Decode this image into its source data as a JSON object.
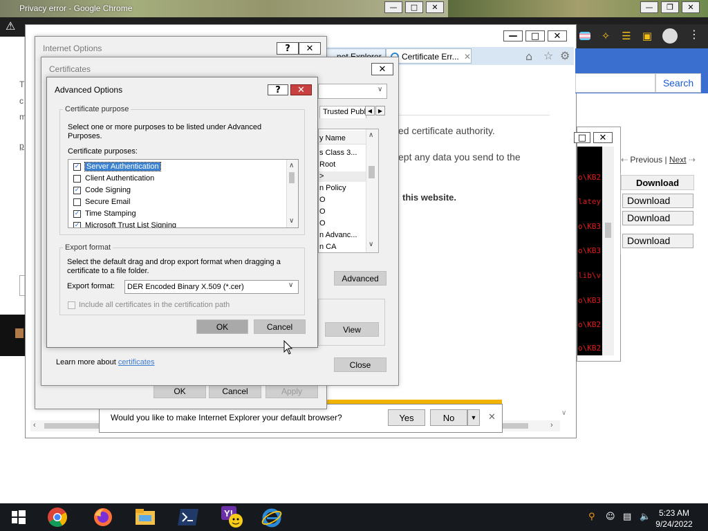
{
  "chrome": {
    "title": "Privacy error - Google Chrome",
    "left_text": [
      "T",
      "c",
      "m",
      "p"
    ]
  },
  "ie": {
    "tabs": [
      "...net Explorer",
      "Certificate Err..."
    ],
    "search_button": "Search",
    "cert_line1": "ed certificate authority.",
    "cert_line2": "ept any data you send to the",
    "cert_bold": "this website.",
    "notification": {
      "question": "Would you like to make Internet Explorer your default browser?",
      "yes": "Yes",
      "no": "No"
    }
  },
  "terminal": {
    "lines": [
      "o\\KB2",
      "latey",
      "o\\KB3",
      "o\\KB3",
      "lib\\v",
      "o\\KB3",
      "o\\KB2",
      "o\\KB2"
    ]
  },
  "downloads": {
    "previous": "Previous",
    "separator": "|",
    "next": "Next",
    "header": "Download",
    "buttons": [
      "Download",
      "Download",
      "Download"
    ]
  },
  "internet_options": {
    "title": "Internet Options",
    "ok": "OK",
    "cancel": "Cancel",
    "apply": "Apply"
  },
  "certificates": {
    "title": "Certificates",
    "tab": "Trusted Publ",
    "list": [
      "y Name",
      "s Class 3...",
      "Root",
      ">",
      "n Policy",
      "O",
      "O",
      "O",
      "n Advanc...",
      "n CA"
    ],
    "advanced": "Advanced",
    "view": "View",
    "close": "Close",
    "learn_more_prefix": "Learn more about",
    "learn_more_link": "certificates"
  },
  "advanced_options": {
    "title": "Advanced Options",
    "help": "?",
    "purpose_group": "Certificate purpose",
    "purpose_desc": "Select one or more purposes to be listed under Advanced Purposes.",
    "purposes_label": "Certificate purposes:",
    "purposes": [
      {
        "label": "Server Authentication",
        "checked": true,
        "selected": true
      },
      {
        "label": "Client Authentication",
        "checked": false,
        "selected": false
      },
      {
        "label": "Code Signing",
        "checked": true,
        "selected": false
      },
      {
        "label": "Secure Email",
        "checked": false,
        "selected": false
      },
      {
        "label": "Time Stamping",
        "checked": true,
        "selected": false
      },
      {
        "label": "Microsoft Trust List Signing",
        "checked": true,
        "selected": false
      }
    ],
    "export_group": "Export format",
    "export_desc": "Select the default drag and drop export format when dragging a certificate to a file folder.",
    "export_label": "Export format:",
    "export_value": "DER Encoded Binary X.509 (*.cer)",
    "include_all": "Include all certificates in the certification path",
    "ok": "OK",
    "cancel": "Cancel"
  },
  "taskbar": {
    "apps": [
      "windows-start",
      "chrome",
      "firefox",
      "file-explorer",
      "powershell",
      "yahoo-messenger",
      "internet-explorer"
    ],
    "time": "5:23 AM",
    "date": "9/24/2022"
  }
}
